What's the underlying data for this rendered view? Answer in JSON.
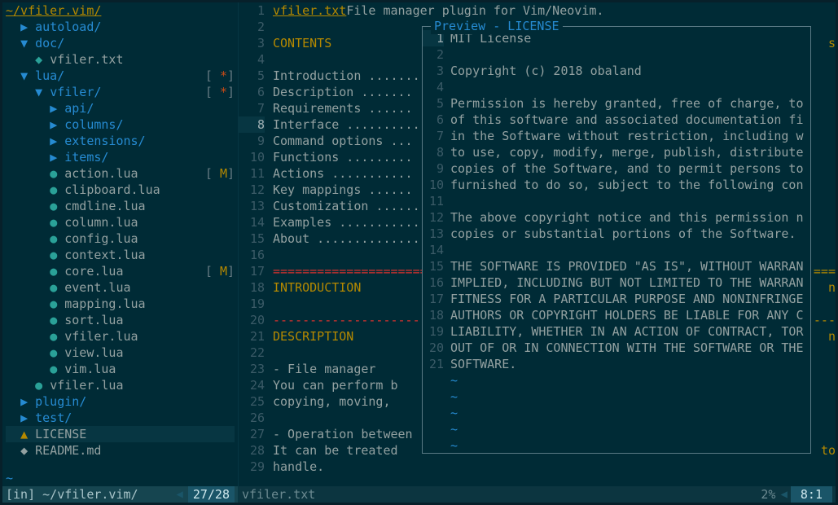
{
  "tree": {
    "header": "~/vfiler.vim/",
    "items": [
      {
        "indent": 1,
        "icon": "▶",
        "name": "autoload/",
        "type": "dir"
      },
      {
        "indent": 1,
        "icon": "▼",
        "name": "doc/",
        "type": "dir"
      },
      {
        "indent": 2,
        "icon": "◆",
        "name": "vfiler.txt",
        "type": "file",
        "iconColor": "file"
      },
      {
        "indent": 1,
        "icon": "▼",
        "name": "lua/",
        "type": "dir",
        "flag": "*"
      },
      {
        "indent": 2,
        "icon": "▼",
        "name": "vfiler/",
        "type": "dir",
        "flag": "*"
      },
      {
        "indent": 3,
        "icon": "▶",
        "name": "api/",
        "type": "dir"
      },
      {
        "indent": 3,
        "icon": "▶",
        "name": "columns/",
        "type": "dir"
      },
      {
        "indent": 3,
        "icon": "▶",
        "name": "extensions/",
        "type": "dir"
      },
      {
        "indent": 3,
        "icon": "▶",
        "name": "items/",
        "type": "dir"
      },
      {
        "indent": 3,
        "icon": "●",
        "name": "action.lua",
        "type": "file",
        "iconColor": "file",
        "flag": "M"
      },
      {
        "indent": 3,
        "icon": "●",
        "name": "clipboard.lua",
        "type": "file",
        "iconColor": "file"
      },
      {
        "indent": 3,
        "icon": "●",
        "name": "cmdline.lua",
        "type": "file",
        "iconColor": "file"
      },
      {
        "indent": 3,
        "icon": "●",
        "name": "column.lua",
        "type": "file",
        "iconColor": "file"
      },
      {
        "indent": 3,
        "icon": "●",
        "name": "config.lua",
        "type": "file",
        "iconColor": "file"
      },
      {
        "indent": 3,
        "icon": "●",
        "name": "context.lua",
        "type": "file",
        "iconColor": "file"
      },
      {
        "indent": 3,
        "icon": "●",
        "name": "core.lua",
        "type": "file",
        "iconColor": "file",
        "flag": "M"
      },
      {
        "indent": 3,
        "icon": "●",
        "name": "event.lua",
        "type": "file",
        "iconColor": "file"
      },
      {
        "indent": 3,
        "icon": "●",
        "name": "mapping.lua",
        "type": "file",
        "iconColor": "file"
      },
      {
        "indent": 3,
        "icon": "●",
        "name": "sort.lua",
        "type": "file",
        "iconColor": "file"
      },
      {
        "indent": 3,
        "icon": "●",
        "name": "vfiler.lua",
        "type": "file",
        "iconColor": "file"
      },
      {
        "indent": 3,
        "icon": "●",
        "name": "view.lua",
        "type": "file",
        "iconColor": "file"
      },
      {
        "indent": 3,
        "icon": "●",
        "name": "vim.lua",
        "type": "file",
        "iconColor": "file"
      },
      {
        "indent": 2,
        "icon": "●",
        "name": "vfiler.lua",
        "type": "file",
        "iconColor": "file"
      },
      {
        "indent": 1,
        "icon": "▶",
        "name": "plugin/",
        "type": "dir"
      },
      {
        "indent": 1,
        "icon": "▶",
        "name": "test/",
        "type": "dir"
      },
      {
        "indent": 1,
        "icon": "▲",
        "name": "LICENSE",
        "type": "file",
        "iconColor": "license",
        "current": true
      },
      {
        "indent": 1,
        "icon": "◆",
        "name": "README.md",
        "type": "file",
        "iconColor": "readme"
      }
    ]
  },
  "leftStatus": {
    "left": "[in] ~/vfiler.vim/",
    "right": "27/28"
  },
  "doc": {
    "lines": [
      {
        "n": 1,
        "text": "vfiler.txt",
        "type": "title",
        "suffix": "  File manager plugin for Vim/Neovim."
      },
      {
        "n": 2,
        "text": "",
        "type": "text"
      },
      {
        "n": 3,
        "text": "CONTENTS",
        "type": "heading",
        "overflow": "s"
      },
      {
        "n": 4,
        "text": "",
        "type": "text"
      },
      {
        "n": 5,
        "text": "Introduction ........",
        "type": "text"
      },
      {
        "n": 6,
        "text": "  Description .......",
        "type": "text"
      },
      {
        "n": 7,
        "text": "  Requirements ......",
        "type": "text"
      },
      {
        "n": 8,
        "text": "Interface ...........",
        "type": "text",
        "current": true
      },
      {
        "n": 9,
        "text": "  Command options ...",
        "type": "text"
      },
      {
        "n": 10,
        "text": "  Functions .........",
        "type": "text"
      },
      {
        "n": 11,
        "text": "  Actions ...........",
        "type": "text"
      },
      {
        "n": 12,
        "text": "  Key mappings ......",
        "type": "text"
      },
      {
        "n": 13,
        "text": "Customization .......",
        "type": "text"
      },
      {
        "n": 14,
        "text": "Examples ............",
        "type": "text"
      },
      {
        "n": 15,
        "text": "About ...............",
        "type": "text"
      },
      {
        "n": 16,
        "text": "",
        "type": "text"
      },
      {
        "n": 17,
        "text": "=======================",
        "type": "hr",
        "overflow": "==="
      },
      {
        "n": 18,
        "text": "INTRODUCTION",
        "type": "heading",
        "overflow": "n"
      },
      {
        "n": 19,
        "text": "",
        "type": "text"
      },
      {
        "n": 20,
        "text": "-----------------------",
        "type": "hr",
        "overflow": "---"
      },
      {
        "n": 21,
        "text": "DESCRIPTION",
        "type": "heading",
        "overflow": "n"
      },
      {
        "n": 22,
        "text": "",
        "type": "text"
      },
      {
        "n": 23,
        "text": "  - File manager",
        "type": "text"
      },
      {
        "n": 24,
        "text": "    You can perform b",
        "type": "text"
      },
      {
        "n": 25,
        "text": "    copying, moving, ",
        "type": "text"
      },
      {
        "n": 26,
        "text": "",
        "type": "text"
      },
      {
        "n": 27,
        "text": "  - Operation between",
        "type": "text"
      },
      {
        "n": 28,
        "text": "    It can be treated",
        "type": "text",
        "overflow": "to"
      },
      {
        "n": 29,
        "text": "    handle.",
        "type": "text"
      }
    ]
  },
  "rightStatus": {
    "left": "vfiler.txt",
    "percent": "2%",
    "pos": "8:1"
  },
  "preview": {
    "title": " Preview - LICENSE ",
    "lines": [
      {
        "n": 1,
        "text": "MIT License",
        "first": true
      },
      {
        "n": 2,
        "text": ""
      },
      {
        "n": 3,
        "text": "Copyright (c) 2018 obaland"
      },
      {
        "n": 4,
        "text": ""
      },
      {
        "n": 5,
        "text": "Permission is hereby granted, free of charge, to"
      },
      {
        "n": 6,
        "text": "of this software and associated documentation fi"
      },
      {
        "n": 7,
        "text": "in the Software without restriction, including w"
      },
      {
        "n": 8,
        "text": "to use, copy, modify, merge, publish, distribute"
      },
      {
        "n": 9,
        "text": "copies of the Software, and to permit persons to"
      },
      {
        "n": 10,
        "text": "furnished to do so, subject to the following con"
      },
      {
        "n": 11,
        "text": ""
      },
      {
        "n": 12,
        "text": "The above copyright notice and this permission n"
      },
      {
        "n": 13,
        "text": "copies or substantial portions of the Software."
      },
      {
        "n": 14,
        "text": ""
      },
      {
        "n": 15,
        "text": "THE SOFTWARE IS PROVIDED \"AS IS\", WITHOUT WARRAN"
      },
      {
        "n": 16,
        "text": "IMPLIED, INCLUDING BUT NOT LIMITED TO THE WARRAN"
      },
      {
        "n": 17,
        "text": "FITNESS FOR A PARTICULAR PURPOSE AND NONINFRINGE"
      },
      {
        "n": 18,
        "text": "AUTHORS OR COPYRIGHT HOLDERS BE LIABLE FOR ANY C"
      },
      {
        "n": 19,
        "text": "LIABILITY, WHETHER IN AN ACTION OF CONTRACT, TOR"
      },
      {
        "n": 20,
        "text": "OUT OF OR IN CONNECTION WITH THE SOFTWARE OR THE"
      },
      {
        "n": 21,
        "text": "SOFTWARE."
      },
      {
        "n": null,
        "text": "~",
        "tilde": true
      },
      {
        "n": null,
        "text": "~",
        "tilde": true
      },
      {
        "n": null,
        "text": "~",
        "tilde": true
      },
      {
        "n": null,
        "text": "~",
        "tilde": true
      },
      {
        "n": null,
        "text": "~",
        "tilde": true
      }
    ]
  }
}
